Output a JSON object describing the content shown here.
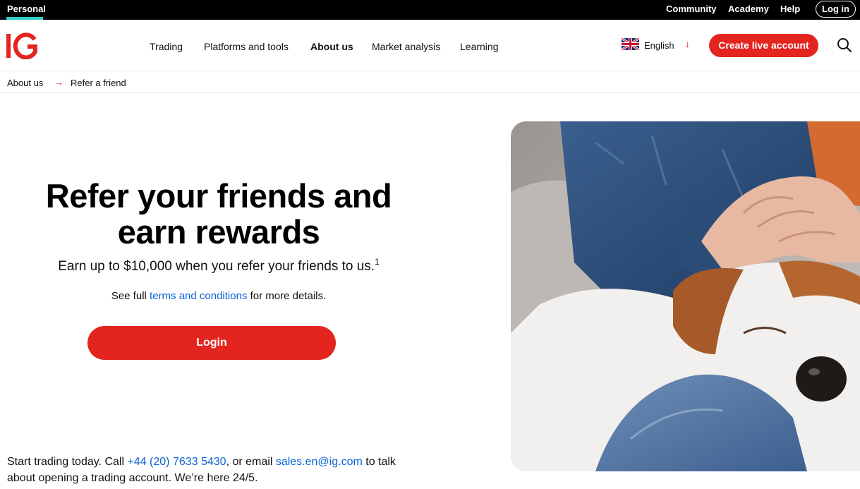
{
  "topbar": {
    "personal": "Personal",
    "links": [
      "Community",
      "Academy",
      "Help"
    ],
    "login": "Log in"
  },
  "header": {
    "logo": "IG",
    "nav": [
      "Trading",
      "Platforms and tools",
      "About us",
      "Market analysis",
      "Learning"
    ],
    "active_nav": "About us",
    "language": "English",
    "create_account": "Create live account"
  },
  "breadcrumb": {
    "parent": "About us",
    "current": "Refer a friend"
  },
  "hero": {
    "title_line1": "Refer your friends and",
    "title_line2": "earn rewards",
    "subtitle": "Earn up to $10,000 when you refer your friends to us.",
    "footnote": "1",
    "terms_prefix": "See full ",
    "terms_link": "terms and conditions",
    "terms_suffix": " for more details.",
    "login_button": "Login"
  },
  "contact": {
    "prefix": "Start trading today. Call ",
    "phone": "+44 (20) 7633 5430",
    "middle": ", or email ",
    "email": "sales.en@ig.com",
    "suffix": " to talk about opening a trading account. We’re here 24/5."
  },
  "colors": {
    "brand_red": "#e4251f",
    "link_blue": "#0b63d6",
    "accent_teal": "#2fd0c7"
  }
}
